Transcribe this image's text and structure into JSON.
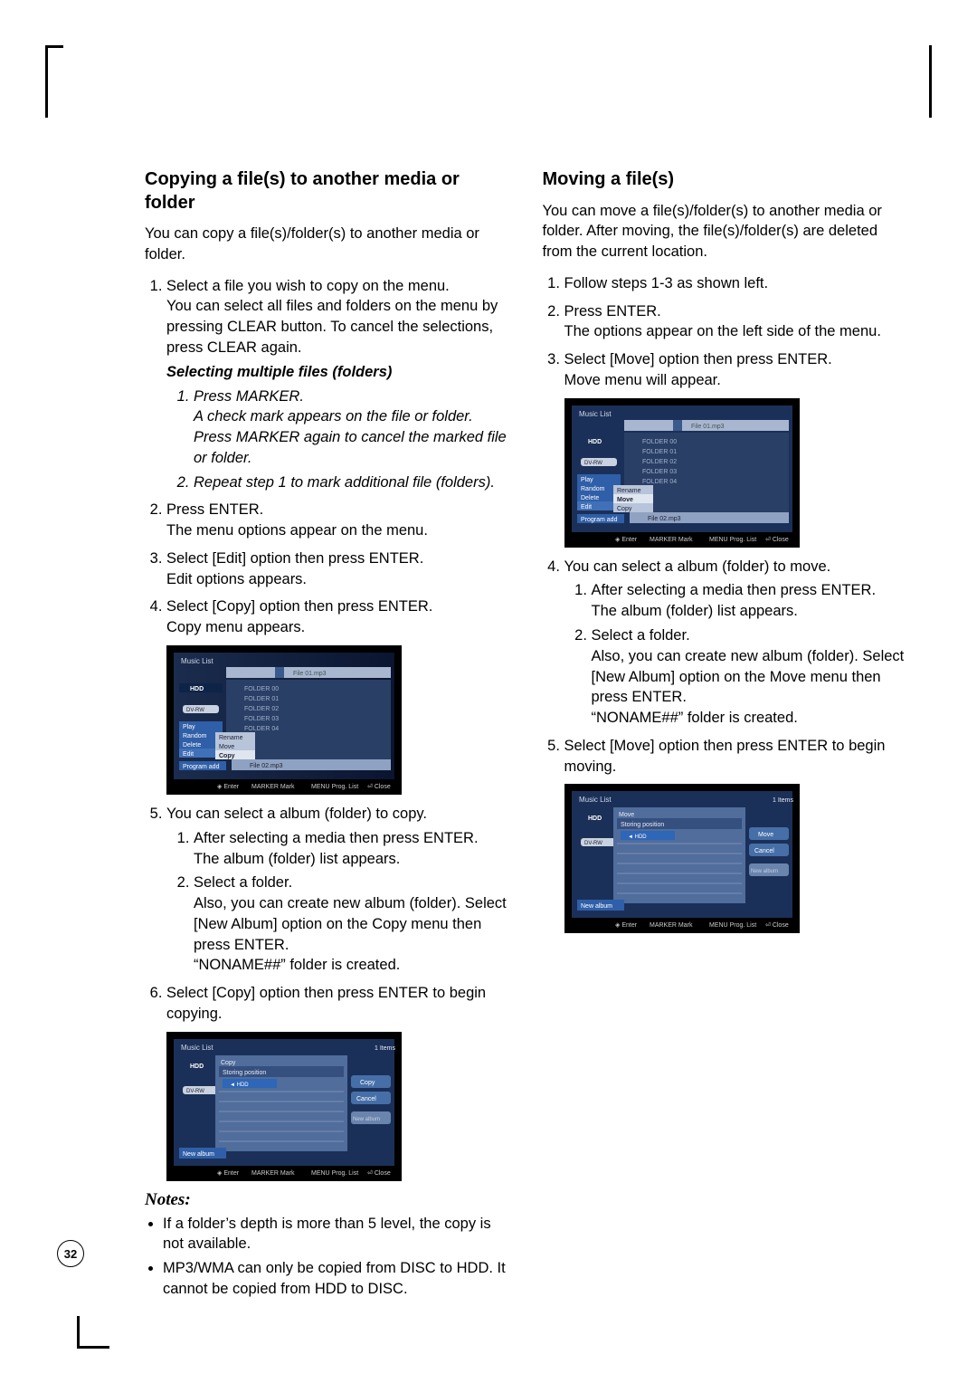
{
  "page_number": "32",
  "left": {
    "heading": "Copying a file(s) to another media or folder",
    "intro": "You can copy a file(s)/folder(s) to another media or folder.",
    "step1a": "Select a file you wish to copy on the menu.",
    "step1b": "You can select all files and folders on the menu by pressing CLEAR button. To cancel the selections, press CLEAR again.",
    "subhead": "Selecting multiple files (folders)",
    "sub1a": "Press MARKER.",
    "sub1b": "A check mark appears on the file or folder.",
    "sub1c": "Press MARKER again to cancel the marked file or folder.",
    "sub2": "Repeat step 1 to mark additional file (folders).",
    "step2a": "Press ENTER.",
    "step2b": "The menu options appear on the menu.",
    "step3a": "Select [Edit] option then press ENTER.",
    "step3b": "Edit options appears.",
    "step4a": "Select [Copy] option then press ENTER.",
    "step4b": "Copy menu appears.",
    "step5": "You can select a album (folder) to copy.",
    "step5_1a": "After selecting a media then press ENTER.",
    "step5_1b": "The album (folder) list appears.",
    "step5_2a": "Select a folder.",
    "step5_2b": "Also, you can create new album (folder). Select [New Album] option on the Copy menu then press ENTER.",
    "step5_2c": "“NONAME##” folder is created.",
    "step6": "Select [Copy] option then press ENTER to begin copying.",
    "notes_head": "Notes:",
    "note1": "If a folder’s depth is more than 5 level, the copy is not available.",
    "note2": "MP3/WMA can only be copied from DISC to HDD. It cannot be copied from HDD to DISC."
  },
  "right": {
    "heading": "Moving a file(s)",
    "intro": "You can move a file(s)/folder(s) to another media or folder. After moving, the file(s)/folder(s) are deleted from the current location.",
    "step1": "Follow steps 1-3 as shown left.",
    "step2a": "Press ENTER.",
    "step2b": "The options appear on the left side of the menu.",
    "step3a": "Select [Move] option then press ENTER.",
    "step3b": "Move menu will appear.",
    "step4": "You can select a album (folder) to move.",
    "step4_1a": "After selecting a media then press ENTER.",
    "step4_1b": "The album (folder) list appears.",
    "step4_2a": "Select a folder.",
    "step4_2b": "Also, you can create new album (folder). Select [New Album] option on the Move menu then press ENTER.",
    "step4_2c": "“NONAME##” folder is created.",
    "step5": "Select [Move] option then press ENTER to begin moving."
  },
  "screens": {
    "title": "Music List",
    "hdd": "HDD",
    "dvd": "DV-RW",
    "file1": "File 01.mp3",
    "file2": "File 02.mp3",
    "folders": [
      "FOLDER 00",
      "FOLDER 01",
      "FOLDER 02",
      "FOLDER 03",
      "FOLDER 04"
    ],
    "menu_play": "Play",
    "menu_random": "Random",
    "menu_delete": "Delete",
    "menu_edit": "Edit",
    "menu_rename": "Rename",
    "menu_move": "Move",
    "menu_copy": "Copy",
    "menu_progadd": "Program add",
    "foot_enter": "Enter",
    "foot_mark": "Mark",
    "foot_prog": "Prog. List",
    "foot_close": "Close",
    "foot_marker": "MARKER",
    "foot_menu": "MENU",
    "copy_head": "Copy",
    "move_head": "Move",
    "storing": "Storing position",
    "btn_copy": "Copy",
    "btn_move": "Move",
    "btn_cancel": "Cancel",
    "btn_newalbum": "New album",
    "newalbum": "New album",
    "items1": "1 Items"
  }
}
